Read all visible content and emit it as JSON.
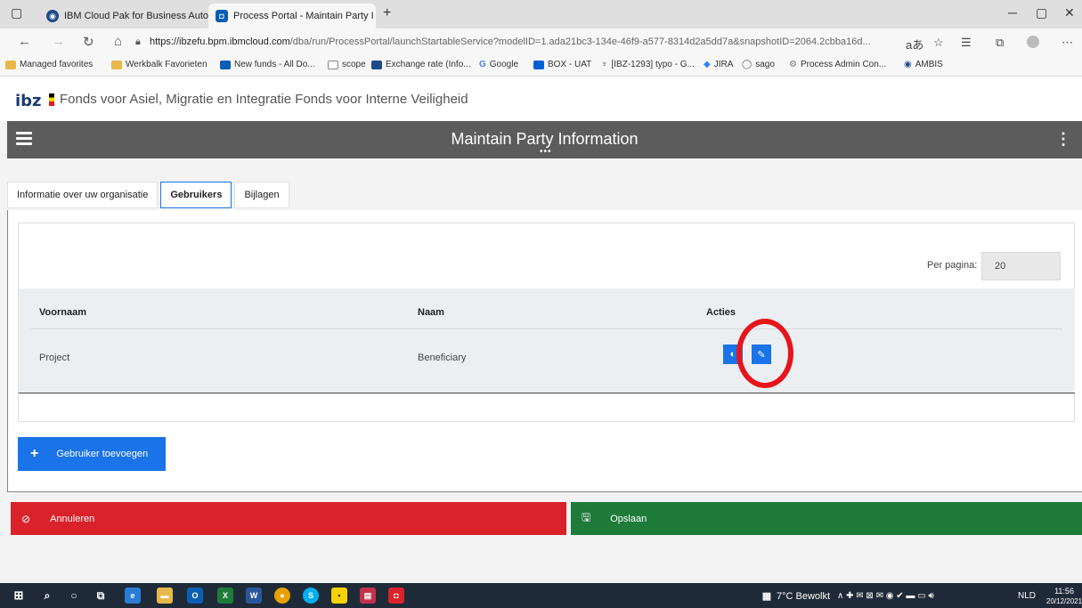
{
  "browser": {
    "tabs": [
      {
        "label": "IBM Cloud Pak for Business Auto",
        "active": false
      },
      {
        "label": "Process Portal - Maintain Party I",
        "active": true
      }
    ],
    "new_tab": "+",
    "url_host": "https://ibzefu.bpm.ibmcloud.com",
    "url_path": "/dba/run/ProcessPortal/launchStartableService?modelID=1.ada21bc3-134e-46f9-a577-8314d2a5dd7a&snapshotID=2064.2cbba16d...",
    "favorites": [
      {
        "label": "Managed favorites",
        "color": "#e8b84a"
      },
      {
        "label": "Werkbalk Favorieten",
        "color": "#e8b84a"
      },
      {
        "label": "New funds - All Do...",
        "color": "#0a5fb4"
      },
      {
        "label": "scope",
        "color": "#888888"
      },
      {
        "label": "Exchange rate (Info...",
        "color": "#1f4a8a"
      },
      {
        "label": "Google",
        "color": "#4285f4"
      },
      {
        "label": "BOX - UAT",
        "color": "#0061d5"
      },
      {
        "label": "[IBZ-1293] typo - G...",
        "color": "#555555"
      },
      {
        "label": "JIRA",
        "color": "#2684ff"
      },
      {
        "label": "sago",
        "color": "#666666"
      },
      {
        "label": "Process Admin Con...",
        "color": "#777777"
      },
      {
        "label": "AMBIS",
        "color": "#1f4a8a"
      }
    ]
  },
  "app": {
    "logo": "ibz",
    "org_title": "Fonds voor Asiel, Migratie en Integratie Fonds voor Interne Veiligheid",
    "page_title": "Maintain Party Information",
    "tabs": [
      {
        "label": "Informatie over uw organisatie"
      },
      {
        "label": "Gebruikers"
      },
      {
        "label": "Bijlagen"
      }
    ],
    "per_page_label": "Per pagina:",
    "per_page_value": "20",
    "table": {
      "headers": [
        "Voornaam",
        "Naam",
        "Acties"
      ],
      "rows": [
        {
          "voornaam": "Project",
          "naam": "Beneficiary"
        }
      ]
    },
    "add_user_label": "Gebruiker toevoegen",
    "cancel_label": "Annuleren",
    "save_label": "Opslaan"
  },
  "taskbar": {
    "weather": "7°C Bewolkt",
    "language": "NLD",
    "time": "11:56",
    "date": "20/12/2021"
  },
  "colors": {
    "accent": "#1a73e8",
    "danger": "#d9222a",
    "success": "#1e7b3a",
    "header": "#5c5c5c",
    "annotation": "#e8141c"
  }
}
